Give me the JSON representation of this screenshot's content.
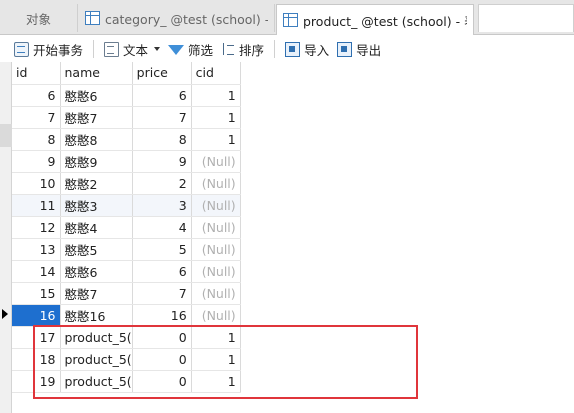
{
  "tabs": [
    {
      "label": "对象",
      "icon": "none"
    },
    {
      "label": "category_ @test (school) - 表",
      "icon": "table-icon"
    },
    {
      "label": "product_ @test (school) - 表",
      "icon": "table-icon"
    }
  ],
  "toolbar": {
    "begin_transaction": "开始事务",
    "text": "文本",
    "filter": "筛选",
    "sort": "排序",
    "import": "导入",
    "export": "导出"
  },
  "grid": {
    "columns": [
      "id",
      "name",
      "price",
      "cid"
    ],
    "rows": [
      {
        "id": "6",
        "name": "憨憨6",
        "price": "6",
        "cid": "1"
      },
      {
        "id": "7",
        "name": "憨憨7",
        "price": "7",
        "cid": "1"
      },
      {
        "id": "8",
        "name": "憨憨8",
        "price": "8",
        "cid": "1"
      },
      {
        "id": "9",
        "name": "憨憨9",
        "price": "9",
        "cid": "(Null)"
      },
      {
        "id": "10",
        "name": "憨憨2",
        "price": "2",
        "cid": "(Null)"
      },
      {
        "id": "11",
        "name": "憨憨3",
        "price": "3",
        "cid": "(Null)"
      },
      {
        "id": "12",
        "name": "憨憨4",
        "price": "4",
        "cid": "(Null)"
      },
      {
        "id": "13",
        "name": "憨憨5",
        "price": "5",
        "cid": "(Null)"
      },
      {
        "id": "14",
        "name": "憨憨6",
        "price": "6",
        "cid": "(Null)"
      },
      {
        "id": "15",
        "name": "憨憨7",
        "price": "7",
        "cid": "(Null)"
      },
      {
        "id": "16",
        "name": "憨憨16",
        "price": "16",
        "cid": "(Null)"
      },
      {
        "id": "17",
        "name": "product_5(",
        "price": "0",
        "cid": "1"
      },
      {
        "id": "18",
        "name": "product_5(",
        "price": "0",
        "cid": "1"
      },
      {
        "id": "19",
        "name": "product_5(",
        "price": "0",
        "cid": "1"
      }
    ],
    "selected_row": 10
  },
  "colors": {
    "selection": "#1e6fcf",
    "highlight_border": "#e0353b",
    "null_text": "#b0b0b0"
  }
}
